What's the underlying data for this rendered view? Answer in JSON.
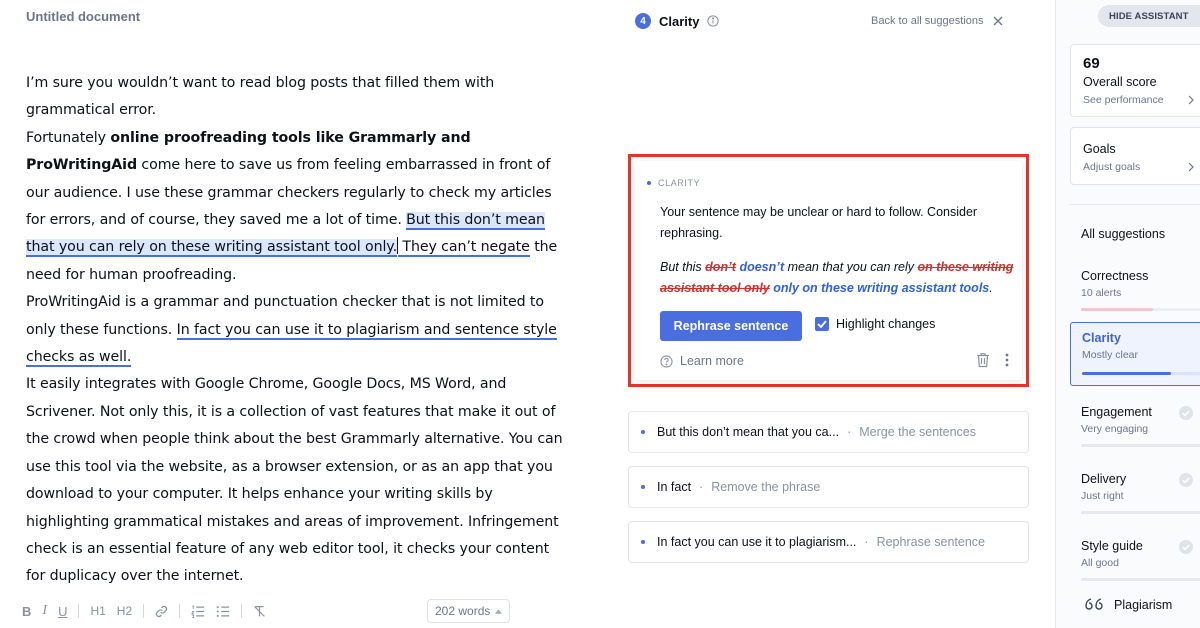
{
  "document": {
    "title": "Untitled document",
    "p1": "I’m sure you wouldn’t want to read blog posts that filled them with grammatical error.",
    "p2_a": "Fortunately ",
    "p2_bold": "online proofreading tools like Grammarly and ProWritingAid",
    "p2_b": " come here to save us from feeling embarrassed in front of our audience. I use these grammar checkers regularly to check my articles for errors, and of course, they saved me a lot of time. ",
    "p2_highlight": "But this don’t mean that you can rely on these writing assistant tool only.",
    "p2_under": " They can’t negate",
    "p2_c": " the need for human proofreading.",
    "p3_a": "ProWritingAid is a grammar and punctuation checker that is not limited to only these functions. ",
    "p3_under": "In fact you can use it to plagiarism and sentence style checks as well.",
    "p4": "It easily integrates with Google Chrome, Google Docs, MS Word, and Scrivener. Not only this, it is a collection of vast features that make it out of the crowd when people think about the best Grammarly alternative. You can use this tool via the website, as a browser extension, or as an app that you download to your computer. It helps enhance your writing skills by highlighting grammatical mistakes and areas of improvement. Infringement check is an essential feature of any web editor tool, it checks your content for duplicacy over the internet.",
    "word_count": "202 words",
    "toolbar": [
      "B",
      "I",
      "U",
      "H1",
      "H2",
      "link-icon",
      "ordered-list-icon",
      "bullet-list-icon",
      "clear-format-icon"
    ]
  },
  "panel": {
    "badge_count": "4",
    "title": "Clarity",
    "back_link": "Back to all suggestions",
    "card": {
      "label": "CLARITY",
      "description": "Your sentence may be unclear or hard to follow. Consider rephrasing.",
      "ex_1": "But this ",
      "ex_del1": "don’t",
      "ex_ins1": "doesn’t",
      "ex_2": " mean that you can rely ",
      "ex_del2": "on these writing assistant tool only",
      "ex_ins2": "only on these writing assistant tools",
      "ex_3": ".",
      "button": "Rephrase sentence",
      "checkbox_label": "Highlight changes",
      "checkbox_checked": true,
      "learn_more": "Learn more"
    },
    "suggestions": [
      {
        "text": "But this don’t mean that you ca...",
        "action": "Merge the sentences"
      },
      {
        "text": "In fact",
        "action": "Remove the phrase"
      },
      {
        "text": "In fact you can use it to plagiarism...",
        "action": "Rephrase sentence"
      }
    ]
  },
  "sidebar": {
    "hide_button": "HIDE ASSISTANT",
    "score": "69",
    "score_label": "Overall score",
    "score_link": "See performance",
    "goals_label": "Goals",
    "goals_link": "Adjust goals",
    "all_suggestions": "All suggestions",
    "categories": [
      {
        "name": "Correctness",
        "status": "10 alerts",
        "progress": 0.6,
        "color": "#f2c5cf"
      },
      {
        "name": "Clarity",
        "status": "Mostly clear",
        "progress": 0.74,
        "color": "#4a6ee0",
        "active": true
      },
      {
        "name": "Engagement",
        "status": "Very engaging",
        "progress": 1.0,
        "color": "#e6e8ee"
      },
      {
        "name": "Delivery",
        "status": "Just right",
        "progress": 1.0,
        "color": "#e6e8ee"
      },
      {
        "name": "Style guide",
        "status": "All good",
        "progress": 1.0,
        "color": "#e6e8ee"
      }
    ],
    "plagiarism": "Plagiarism"
  },
  "colors": {
    "accent": "#4a6ee0",
    "highlight_border": "#e8322a",
    "deleted": "#d0312d",
    "inserted": "#2e60e0"
  }
}
